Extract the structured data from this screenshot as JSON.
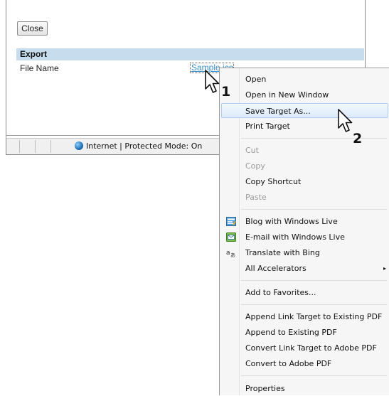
{
  "page": {
    "close_label": "Close",
    "section_title": "Export",
    "file_name_label": "File Name",
    "file_link_text": "Sample.ico"
  },
  "status_bar": {
    "zone_text": "Internet | Protected Mode: On",
    "zone_icon": "globe-icon"
  },
  "context_menu": {
    "items": [
      {
        "label": "Open",
        "state": "normal"
      },
      {
        "label": "Open in New Window",
        "state": "normal"
      },
      {
        "label": "Save Target As...",
        "state": "highlighted"
      },
      {
        "label": "Print Target",
        "state": "normal"
      },
      {
        "label": "Cut",
        "state": "disabled"
      },
      {
        "label": "Copy",
        "state": "disabled"
      },
      {
        "label": "Copy Shortcut",
        "state": "normal"
      },
      {
        "label": "Paste",
        "state": "disabled"
      },
      {
        "label": "Blog with Windows Live",
        "icon": "blog-icon"
      },
      {
        "label": "E-mail with Windows Live",
        "icon": "email-icon"
      },
      {
        "label": "Translate with Bing",
        "icon": "translate-icon"
      },
      {
        "label": "All Accelerators",
        "submenu": true
      },
      {
        "label": "Add to Favorites..."
      },
      {
        "label": "Append Link Target to Existing PDF"
      },
      {
        "label": "Append to Existing PDF"
      },
      {
        "label": "Convert Link Target to Adobe PDF"
      },
      {
        "label": "Convert to Adobe PDF"
      },
      {
        "label": "Properties"
      }
    ],
    "submenu_arrow": "▸"
  },
  "callouts": {
    "step1": "1",
    "step2": "2"
  },
  "colors": {
    "export_bar": "#c7dcec",
    "link": "#3a8fc8",
    "menu_highlight": "#dcebfc"
  }
}
